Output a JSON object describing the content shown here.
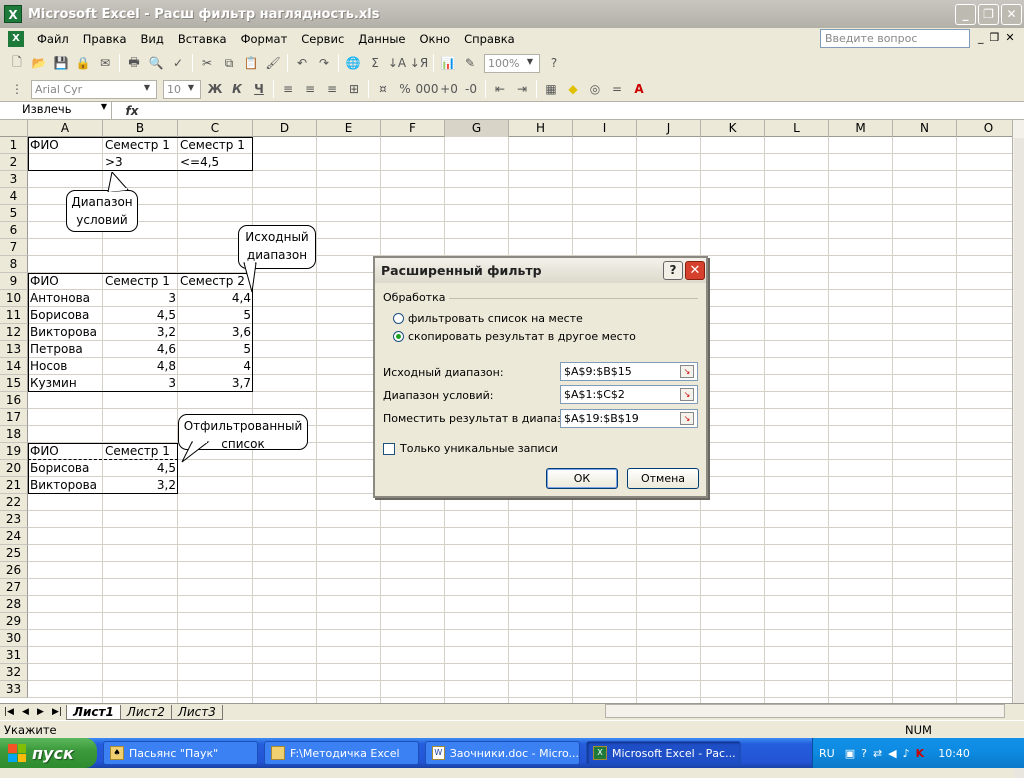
{
  "window": {
    "title": "Microsoft Excel - Расш фильтр наглядность.xls",
    "app_icon": "X"
  },
  "menu": {
    "items": [
      "Файл",
      "Правка",
      "Вид",
      "Вставка",
      "Формат",
      "Сервис",
      "Данные",
      "Окно",
      "Справка"
    ],
    "ask_placeholder": "Введите вопрос"
  },
  "toolbar": {
    "zoom": "100%",
    "font": "Arial Cyr",
    "font_size": "10"
  },
  "formula_bar": {
    "name_box": "Извлечь",
    "fx": "fx"
  },
  "columns": [
    "A",
    "B",
    "C",
    "D",
    "E",
    "F",
    "G",
    "H",
    "I",
    "J",
    "K",
    "L",
    "M",
    "N",
    "O"
  ],
  "rows": [
    "1",
    "2",
    "3",
    "4",
    "5",
    "6",
    "7",
    "8",
    "9",
    "10",
    "11",
    "12",
    "13",
    "14",
    "15",
    "16",
    "17",
    "18",
    "19",
    "20",
    "21",
    "22",
    "23",
    "24",
    "25",
    "26",
    "27",
    "28",
    "29",
    "30",
    "31",
    "32",
    "33"
  ],
  "cells": {
    "A1": "ФИО",
    "B1": "Семестр 1",
    "C1": "Семестр 1",
    "B2": ">3",
    "C2": "<=4,5",
    "A9": "ФИО",
    "B9": "Семестр 1",
    "C9": "Семестр 2",
    "A10": "Антонова",
    "B10": "3",
    "C10": "4,4",
    "A11": "Борисова",
    "B11": "4,5",
    "C11": "5",
    "A12": "Викторова",
    "B12": "3,2",
    "C12": "3,6",
    "A13": "Петрова",
    "B13": "4,6",
    "C13": "5",
    "A14": "Носов",
    "B14": "4,8",
    "C14": "4",
    "A15": "Кузмин",
    "B15": "3",
    "C15": "3,7",
    "A19": "ФИО",
    "B19": "Семестр 1",
    "A20": "Борисова",
    "B20": "4,5",
    "A21": "Викторова",
    "B21": "3,2"
  },
  "callouts": {
    "criteria": "Диапазон условий",
    "source": "Исходный диапазон",
    "filtered": "Отфильтрованный список"
  },
  "sheet_tabs": [
    "Лист1",
    "Лист2",
    "Лист3"
  ],
  "status": {
    "left": "Укажите",
    "num": "NUM"
  },
  "dialog": {
    "title": "Расширенный фильтр",
    "help": "?",
    "close": "✕",
    "group_label": "Обработка",
    "radio1": "фильтровать список на месте",
    "radio2": "скопировать результат в другое место",
    "source_label": "Исходный диапазон:",
    "source_value": "$A$9:$B$15",
    "criteria_label": "Диапазон условий:",
    "criteria_value": "$A$1:$C$2",
    "dest_label": "Поместить результат в диапазон:",
    "dest_value": "$A$19:$B$19",
    "unique_label": "Только уникальные записи",
    "ok": "ОК",
    "cancel": "Отмена"
  },
  "taskbar": {
    "start": "пуск",
    "buttons": [
      "Пасьянс \"Паук\"",
      "F:\\Методичка Excel",
      "Заочники.doc - Micro...",
      "Microsoft Excel - Рас..."
    ],
    "lang": "RU",
    "clock": "10:40"
  }
}
